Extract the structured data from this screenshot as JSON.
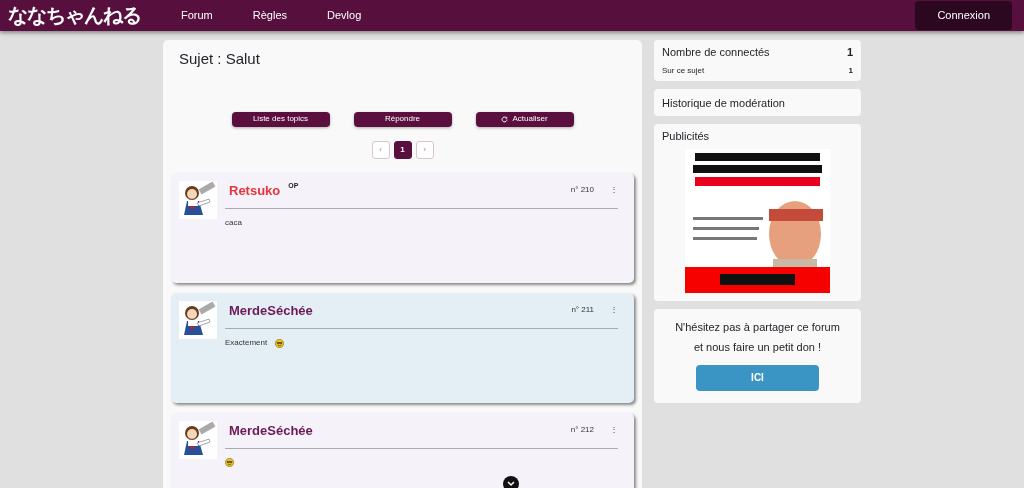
{
  "navbar": {
    "logo": "ななちゃんねる",
    "links": [
      {
        "label": "Forum"
      },
      {
        "label": "Règles"
      },
      {
        "label": "Devlog"
      }
    ],
    "login": "Connexion"
  },
  "topic": {
    "title": "Sujet : Salut",
    "buttons": [
      {
        "label": "Liste des topics",
        "kind": "plain"
      },
      {
        "label": "Répondre",
        "kind": "plain"
      },
      {
        "label": "Actualiser",
        "kind": "refresh"
      }
    ],
    "pagination": {
      "prev": "‹",
      "pages": [
        {
          "label": "1",
          "selected": true
        }
      ],
      "next": "›"
    }
  },
  "posts": [
    {
      "author": "Retsuko",
      "color": "#e8343c",
      "badge": "OP",
      "number": "n° 210",
      "menu": "⋮",
      "highlighted": false,
      "text": "caca",
      "emoji": false
    },
    {
      "author": "MerdeSéchée",
      "color": "#6b1a55",
      "number": "n° 211",
      "menu": "⋮",
      "highlighted": true,
      "text": "Exactement",
      "emoji": true
    },
    {
      "author": "MerdeSéchée",
      "color": "#6b1a55",
      "number": "n° 212",
      "menu": "⋮",
      "highlighted": false,
      "emoji": true
    }
  ],
  "sidebar": {
    "connected": {
      "label": "Nombre de connectés",
      "count": "1",
      "sub_label": "Sur ce sujet",
      "sub_count": "1"
    },
    "moderation": "Historique de modération",
    "ads": {
      "title": "Publicités"
    },
    "donate": {
      "text": "N'hésitez pas à partager ce forum et nous faire un petit don !",
      "button": "ICI"
    }
  }
}
